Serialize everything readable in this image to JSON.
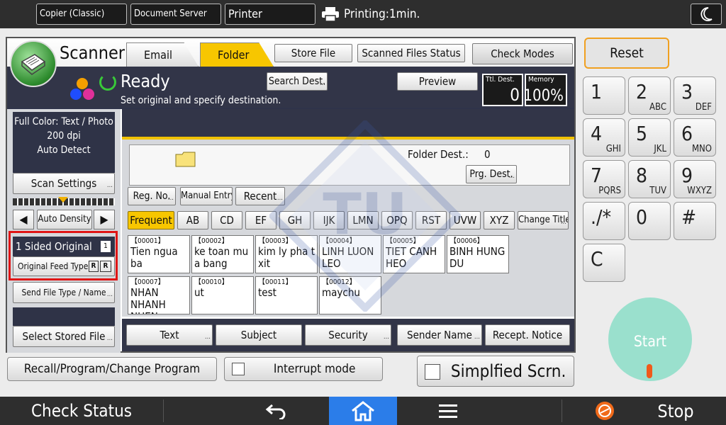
{
  "topbar": {
    "tab_copier": "Copier (Classic)",
    "tab_docserver": "Document Server",
    "tab_printer": "Printer",
    "print_status": "Printing:1min."
  },
  "header": {
    "title": "Scanner",
    "store_file": "Store File",
    "scanned_status": "Scanned Files Status",
    "check_modes": "Check Modes",
    "ready": "Ready",
    "ready_sub": "Set original and specify destination.",
    "search_dest": "Search Dest.",
    "preview": "Preview",
    "ttl_dest_label": "Ttl. Dest.",
    "ttl_dest_value": "0",
    "memory_label": "Memory",
    "memory_value": "100%"
  },
  "left": {
    "info_line1": "Full Color: Text / Photo",
    "info_line2": "200 dpi",
    "info_line3": "Auto Detect",
    "scan_settings": "Scan Settings",
    "auto_density": "Auto Density",
    "left_arrow": "◀",
    "right_arrow": "▶",
    "sided_original": "1 Sided Original",
    "original_feed_type": "Original Feed Type",
    "send_file_type": "Send File Type / Name",
    "select_stored_file": "Select Stored File"
  },
  "tabs": {
    "email": "Email",
    "folder": "Folder"
  },
  "folder": {
    "dest_label": "Folder Dest.:",
    "dest_count": "0",
    "prg_dest": "Prg. Dest.",
    "reg_no": "Reg. No.",
    "manual_entry": "Manual Entry",
    "recent": "Recent"
  },
  "filter_keys": [
    "Frequent",
    "AB",
    "CD",
    "EF",
    "GH",
    "IJK",
    "LMN",
    "OPQ",
    "RST",
    "UVW",
    "XYZ"
  ],
  "change_title": "Change Title",
  "destinations": [
    {
      "num": "【00001】",
      "name": "Tien ngua ba"
    },
    {
      "num": "【00002】",
      "name": "ke toan mu a bang"
    },
    {
      "num": "【00003】",
      "name": "kim ly pha t xit"
    },
    {
      "num": "【00004】",
      "name": "LINH LUON LEO"
    },
    {
      "num": "【00005】",
      "name": "TIET CANH HEO"
    },
    {
      "num": "【00006】",
      "name": "BINH HUNG DU"
    },
    {
      "num": "【00007】",
      "name": "NHAN NHANH NHEN"
    },
    {
      "num": "【00010】",
      "name": "ut"
    },
    {
      "num": "【00011】",
      "name": "test"
    },
    {
      "num": "【00012】",
      "name": "maychu"
    }
  ],
  "bottom_options": {
    "text": "Text",
    "subject": "Subject",
    "security": "Security",
    "sender_name": "Sender Name",
    "recept_notice": "Recept. Notice"
  },
  "lower_row": {
    "recall": "Recall/Program/Change Program",
    "interrupt": "Interrupt mode",
    "simplified": "Simplfied Scrn."
  },
  "keypad": {
    "reset": "Reset",
    "keys": [
      {
        "main": "1",
        "sub": ""
      },
      {
        "main": "2",
        "sub": "ABC"
      },
      {
        "main": "3",
        "sub": "DEF"
      },
      {
        "main": "4",
        "sub": "GHI"
      },
      {
        "main": "5",
        "sub": "JKL"
      },
      {
        "main": "6",
        "sub": "MNO"
      },
      {
        "main": "7",
        "sub": "PQRS"
      },
      {
        "main": "8",
        "sub": "TUV"
      },
      {
        "main": "9",
        "sub": "WXYZ"
      },
      {
        "main": "./*",
        "sub": ""
      },
      {
        "main": "0",
        "sub": ""
      },
      {
        "main": "#",
        "sub": ""
      },
      {
        "main": "C",
        "sub": ""
      }
    ],
    "start": "Start"
  },
  "bottombar": {
    "check_status": "Check Status",
    "stop": "Stop"
  },
  "colors": {
    "accent_yellow": "#f7c600",
    "highlight_red": "#e01515",
    "start_teal": "#9ae0cd",
    "dark_panel": "#323548"
  }
}
